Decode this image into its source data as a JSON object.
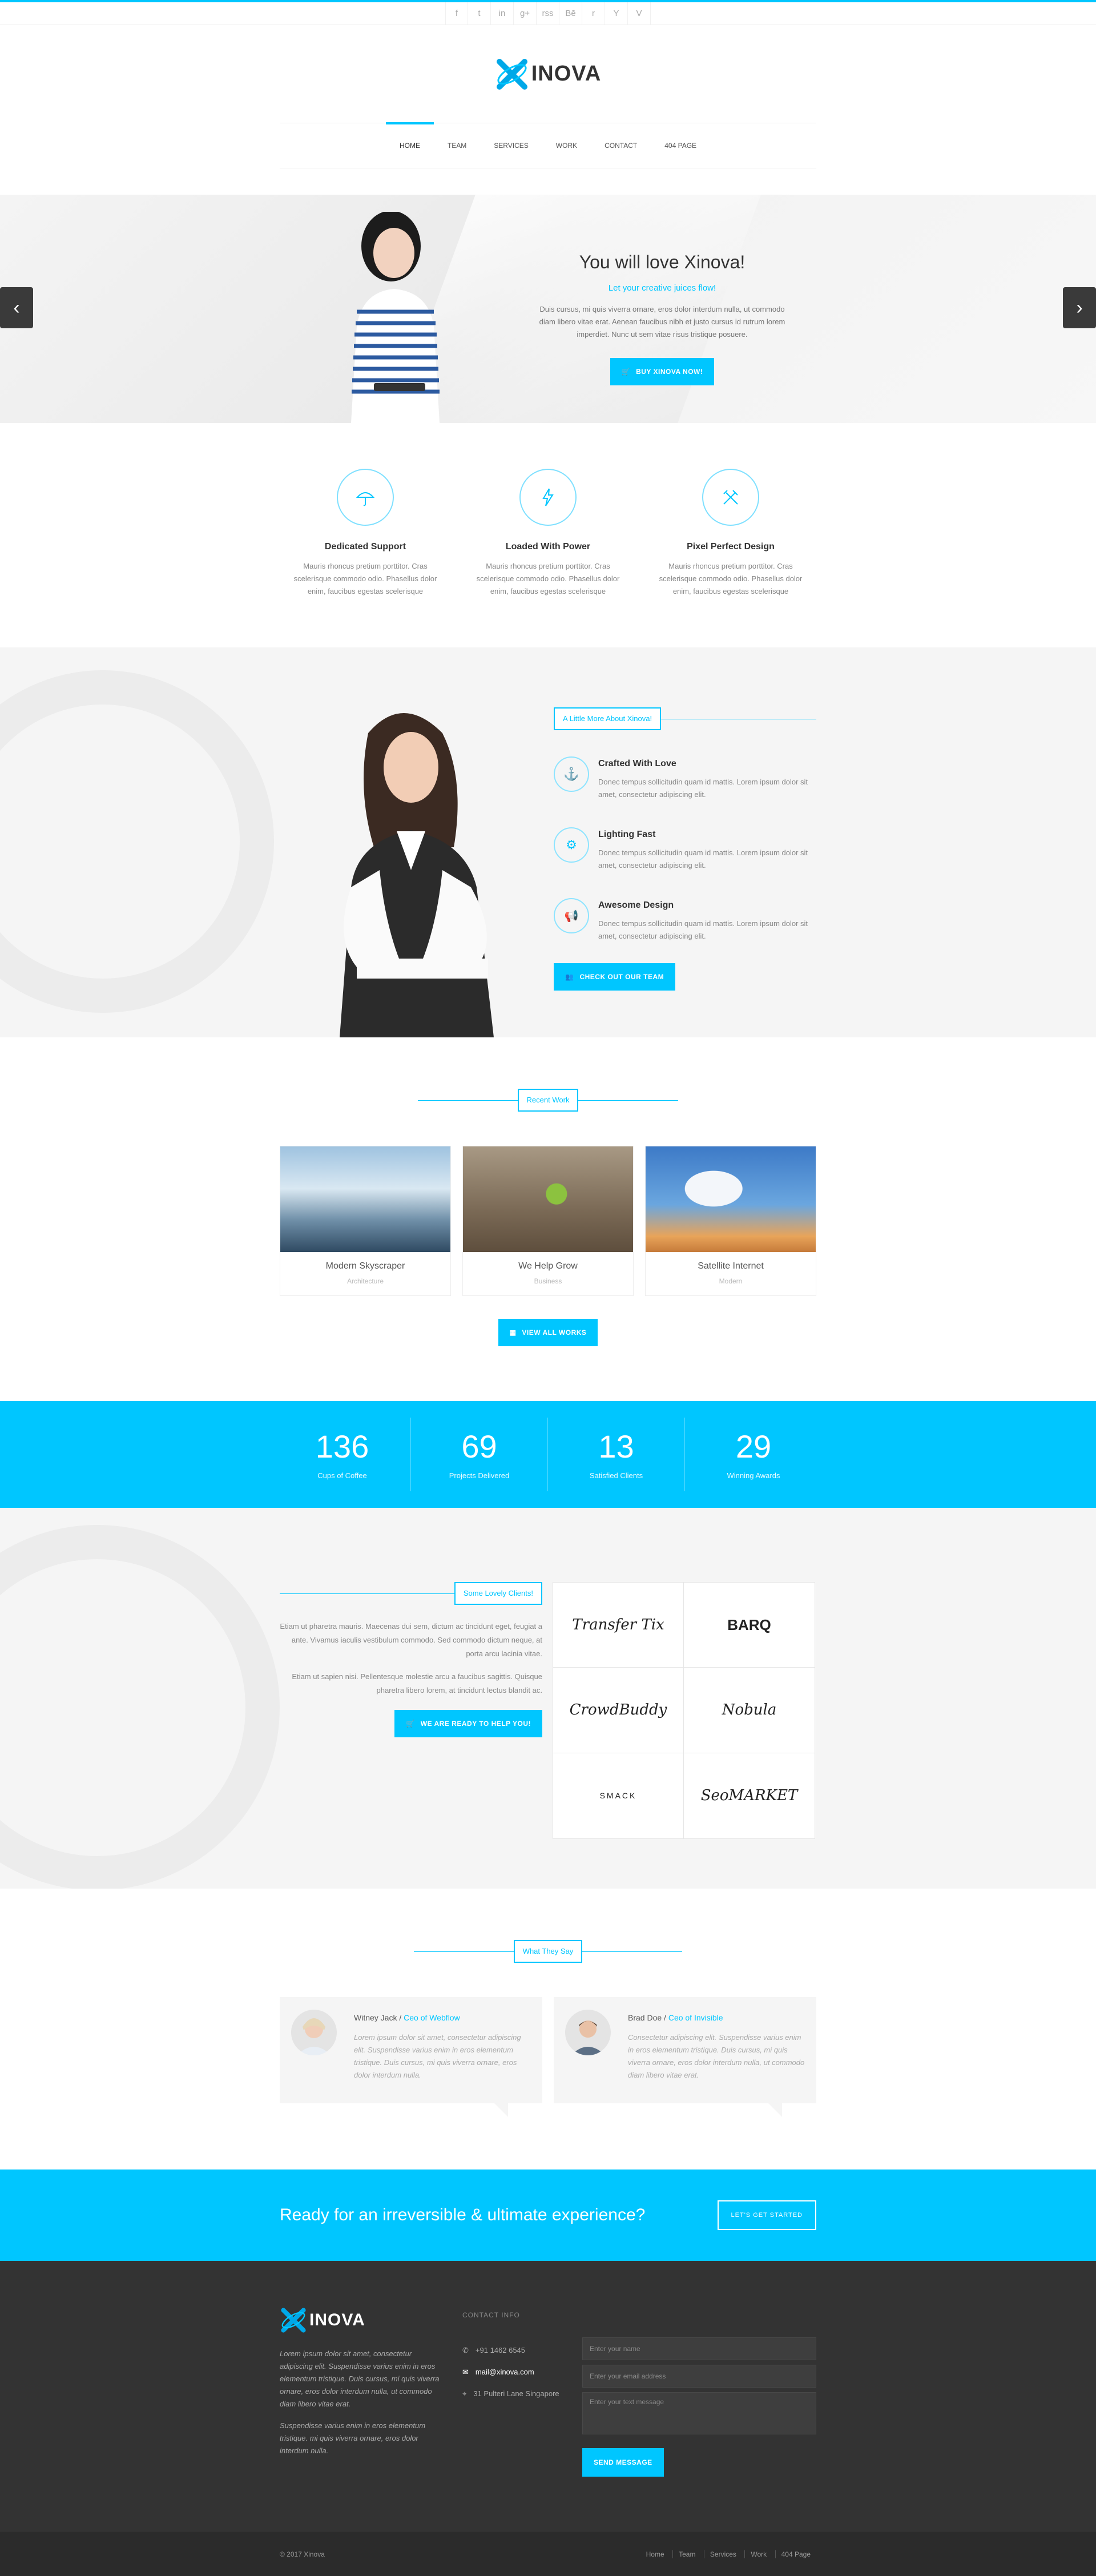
{
  "social": [
    "f",
    "t",
    "in",
    "g+",
    "rss",
    "Bē",
    "r",
    "Y",
    "V"
  ],
  "brand": {
    "name": "INOVA",
    "accent": "#00c6ff"
  },
  "nav": [
    "HOME",
    "TEAM",
    "SERVICES",
    "WORK",
    "CONTACT",
    "404 PAGE"
  ],
  "hero": {
    "title": "You will love Xinova!",
    "subtitle": "Let your creative juices flow!",
    "desc": "Duis cursus, mi quis viverra ornare, eros dolor interdum nulla, ut commodo diam libero vitae erat. Aenean faucibus nibh et justo cursus id rutrum lorem imperdiet. Nunc ut sem vitae risus tristique posuere.",
    "button": "BUY XINOVA NOW!"
  },
  "features": [
    {
      "title": "Dedicated Support",
      "text": "Mauris rhoncus pretium porttitor. Cras scelerisque commodo odio. Phasellus dolor enim, faucibus egestas scelerisque",
      "icon": "umbrella-icon"
    },
    {
      "title": "Loaded With Power",
      "text": "Mauris rhoncus pretium porttitor. Cras scelerisque commodo odio. Phasellus dolor enim, faucibus egestas scelerisque",
      "icon": "bolt-icon"
    },
    {
      "title": "Pixel Perfect Design",
      "text": "Mauris rhoncus pretium porttitor. Cras scelerisque commodo odio. Phasellus dolor enim, faucibus egestas scelerisque",
      "icon": "tools-icon"
    }
  ],
  "about": {
    "title": "A Little More About Xinova!",
    "items": [
      {
        "title": "Crafted With Love",
        "text": "Donec tempus sollicitudin quam id mattis. Lorem ipsum dolor sit amet, consectetur adipiscing elit.",
        "icon": "anchor-icon"
      },
      {
        "title": "Lighting Fast",
        "text": "Donec tempus sollicitudin quam id mattis. Lorem ipsum dolor sit amet, consectetur adipiscing elit.",
        "icon": "gear-icon"
      },
      {
        "title": "Awesome Design",
        "text": "Donec tempus sollicitudin quam id mattis. Lorem ipsum dolor sit amet, consectetur adipiscing elit.",
        "icon": "megaphone-icon"
      }
    ],
    "button": "CHECK OUT OUR TEAM"
  },
  "work": {
    "title": "Recent Work",
    "items": [
      {
        "title": "Modern Skyscraper",
        "cat": "Architecture"
      },
      {
        "title": "We Help Grow",
        "cat": "Business"
      },
      {
        "title": "Satellite Internet",
        "cat": "Modern"
      }
    ],
    "button": "VIEW ALL WORKS"
  },
  "counters": [
    {
      "num": "136",
      "label": "Cups of Coffee"
    },
    {
      "num": "69",
      "label": "Projects Delivered"
    },
    {
      "num": "13",
      "label": "Satisfied Clients"
    },
    {
      "num": "29",
      "label": "Winning Awards"
    }
  ],
  "clients": {
    "title": "Some Lovely Clients!",
    "p1": "Etiam ut pharetra mauris. Maecenas dui sem, dictum ac tincidunt eget, feugiat a ante. Vivamus iaculis vestibulum commodo. Sed commodo dictum neque, at porta arcu lacinia vitae.",
    "p2": "Etiam ut sapien nisi. Pellentesque molestie arcu a faucibus sagittis. Quisque pharetra libero lorem, at tincidunt lectus blandit ac.",
    "button": "WE ARE READY TO HELP YOU!",
    "logos": [
      "Transfer Tix",
      "BARQ",
      "CrowdBuddy",
      "Nobula",
      "SMACK",
      "SeoMARKET"
    ]
  },
  "testimonials": {
    "title": "What They Say",
    "items": [
      {
        "name": "Witney Jack",
        "role": "Ceo of Webflow",
        "quote": "Lorem ipsum dolor sit amet, consectetur adipiscing elit. Suspendisse varius enim in eros elementum tristique. Duis cursus, mi quis viverra ornare, eros dolor interdum nulla."
      },
      {
        "name": "Brad Doe",
        "role": "Ceo of Invisible",
        "quote": "Consectetur adipiscing elit. Suspendisse varius enim in eros elementum tristique. Duis cursus, mi quis viverra ornare, eros dolor interdum nulla, ut commodo diam libero vitae erat."
      }
    ]
  },
  "cta": {
    "text": "Ready for an irreversible & ultimate experience?",
    "button": "LET'S GET STARTED"
  },
  "footer": {
    "about1": "Lorem ipsum dolor sit amet, consectetur adipiscing elit. Suspendisse varius enim in eros elementum tristique. Duis cursus, mi quis viverra ornare, eros dolor interdum nulla, ut commodo diam libero vitae erat.",
    "about2": "Suspendisse varius enim in eros elementum tristique. mi quis viverra ornare, eros dolor interdum nulla.",
    "contact_head": "CONTACT INFO",
    "phone": "+91 1462 6545",
    "email": "mail@xinova.com",
    "address": "31 Pulteri Lane Singapore",
    "name_ph": "Enter your name",
    "email_ph": "Enter your email address",
    "msg_ph": "Enter your text message",
    "send": "SEND MESSAGE",
    "copy": "© 2017 Xinova",
    "links": [
      "Home",
      "Team",
      "Services",
      "Work",
      "404 Page"
    ]
  }
}
